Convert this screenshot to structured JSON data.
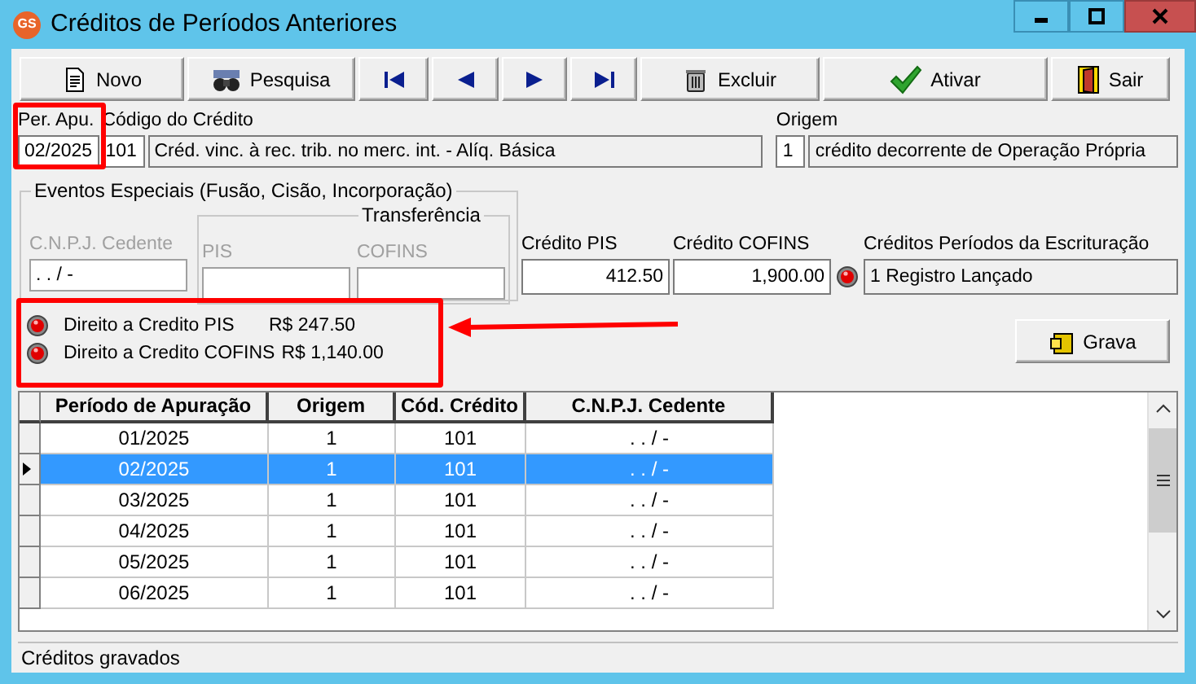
{
  "window": {
    "title": "Créditos de Períodos Anteriores",
    "app_icon_text": "GS"
  },
  "toolbar": [
    {
      "kind": "new",
      "label": "Novo"
    },
    {
      "kind": "search",
      "label": "Pesquisa"
    },
    {
      "kind": "first"
    },
    {
      "kind": "prev"
    },
    {
      "kind": "next"
    },
    {
      "kind": "last"
    },
    {
      "kind": "delete",
      "label": "Excluir"
    },
    {
      "kind": "activate",
      "label": "Ativar"
    },
    {
      "kind": "exit",
      "label": "Sair"
    }
  ],
  "header": {
    "period": {
      "label": "Per. Apu.",
      "value": "02/2025",
      "highlighted": true
    },
    "credit_code": {
      "label": "Código do Crédito",
      "code": "101",
      "description": "Créd. vinc. à rec. trib. no merc. int. - Alíq. Básica"
    },
    "origin": {
      "label": "Origem",
      "code": "1",
      "description": "crédito decorrente de Operação Própria"
    }
  },
  "special_events": {
    "title": "Eventos Especiais (Fusão, Cisão, Incorporação)",
    "transfer_title": "Transferência",
    "cnpj": {
      "label": "C.N.P.J. Cedente",
      "value": ". . / -",
      "disabled": true
    },
    "pis": {
      "label": "PIS",
      "disabled": true
    },
    "cofins": {
      "label": "COFINS",
      "disabled": true
    }
  },
  "credit_pis": {
    "label": "Crédito PIS",
    "value": "412.50"
  },
  "credit_cofins": {
    "label": "Crédito COFINS",
    "value": "1,900.00"
  },
  "period_credits": {
    "label": "Créditos Períodos da Escrituração",
    "value": "1 Registro Lançado"
  },
  "rights": {
    "highlighted": true,
    "items": [
      {
        "label": "Direito a Credito PIS",
        "amount": "R$ 247.50"
      },
      {
        "label": "Direito a Credito COFINS",
        "amount": "R$ 1,140.00"
      }
    ]
  },
  "annotation_arrow": true,
  "save_button": {
    "label": "Grava"
  },
  "grid": {
    "columns": [
      "Período de Apuração",
      "Origem",
      "Cód. Crédito",
      "C.N.P.J. Cedente"
    ],
    "rows": [
      {
        "cells": [
          "01/2025",
          "1",
          "101",
          ". . / -"
        ],
        "selected": false
      },
      {
        "cells": [
          "02/2025",
          "1",
          "101",
          ". . / -"
        ],
        "selected": true
      },
      {
        "cells": [
          "03/2025",
          "1",
          "101",
          ". . / -"
        ],
        "selected": false
      },
      {
        "cells": [
          "04/2025",
          "1",
          "101",
          ". . / -"
        ],
        "selected": false
      },
      {
        "cells": [
          "05/2025",
          "1",
          "101",
          ". . / -"
        ],
        "selected": false
      },
      {
        "cells": [
          "06/2025",
          "1",
          "101",
          ". . / -"
        ],
        "selected": false
      }
    ]
  },
  "status_bar": "Créditos gravados"
}
